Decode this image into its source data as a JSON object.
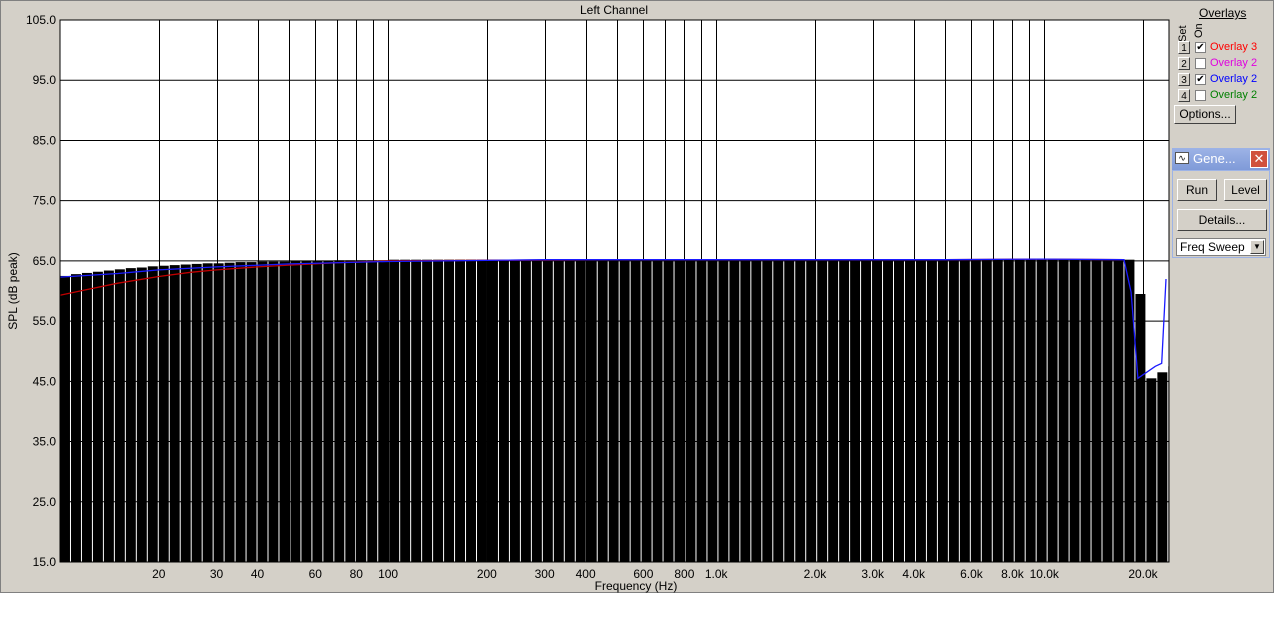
{
  "chart_data": {
    "type": "bar",
    "title": "Left Channel",
    "xlabel": "Frequency (Hz)",
    "ylabel": "SPL (dB peak)",
    "xscale": "log",
    "xlim": [
      10,
      24000
    ],
    "ylim": [
      15,
      105
    ],
    "yticks": [
      "15.0",
      "25.0",
      "35.0",
      "45.0",
      "55.0",
      "65.0",
      "75.0",
      "85.0",
      "95.0",
      "105.0"
    ],
    "xticks": [
      {
        "value": 20,
        "label": "20"
      },
      {
        "value": 30,
        "label": "30"
      },
      {
        "value": 40,
        "label": "40"
      },
      {
        "value": 60,
        "label": "60"
      },
      {
        "value": 80,
        "label": "80"
      },
      {
        "value": 100,
        "label": "100"
      },
      {
        "value": 200,
        "label": "200"
      },
      {
        "value": 300,
        "label": "300"
      },
      {
        "value": 400,
        "label": "400"
      },
      {
        "value": 600,
        "label": "600"
      },
      {
        "value": 800,
        "label": "800"
      },
      {
        "value": 1000,
        "label": "1.0k"
      },
      {
        "value": 2000,
        "label": "2.0k"
      },
      {
        "value": 3000,
        "label": "3.0k"
      },
      {
        "value": 4000,
        "label": "4.0k"
      },
      {
        "value": 6000,
        "label": "6.0k"
      },
      {
        "value": 8000,
        "label": "8.0k"
      },
      {
        "value": 10000,
        "label": "10.0k"
      },
      {
        "value": 20000,
        "label": "20.0k"
      }
    ],
    "xgrid": [
      20,
      30,
      40,
      50,
      60,
      70,
      80,
      90,
      100,
      200,
      300,
      400,
      500,
      600,
      700,
      800,
      900,
      1000,
      2000,
      3000,
      4000,
      5000,
      6000,
      7000,
      8000,
      9000,
      10000,
      20000
    ],
    "grid": true,
    "bars_per_octave": 9,
    "bar_levels": [
      62.5,
      62.8,
      63.0,
      63.2,
      63.4,
      63.6,
      63.8,
      63.9,
      64.1,
      64.2,
      64.3,
      64.4,
      64.5,
      64.6,
      64.6,
      64.7,
      64.8,
      64.8,
      64.9,
      64.9,
      64.9,
      65.0,
      65.0,
      65.0,
      65.0,
      65.1,
      65.1,
      65.1,
      65.1,
      65.1,
      65.2,
      65.2,
      65.2,
      65.2,
      65.2,
      65.2,
      65.2,
      65.2,
      65.2,
      65.2,
      65.2,
      65.2,
      65.2,
      65.2,
      65.2,
      65.2,
      65.2,
      65.2,
      65.2,
      65.2,
      65.2,
      65.2,
      65.2,
      65.2,
      65.2,
      65.2,
      65.2,
      65.2,
      65.2,
      65.2,
      65.2,
      65.2,
      65.2,
      65.2,
      65.2,
      65.2,
      65.2,
      65.2,
      65.2,
      65.2,
      65.2,
      65.2,
      65.2,
      65.2,
      65.2,
      65.2,
      65.2,
      65.2,
      65.2,
      65.2,
      65.2,
      65.2,
      65.2,
      65.2,
      65.2,
      65.2,
      65.2,
      65.2,
      65.2,
      65.2,
      65.2,
      65.2,
      65.2,
      65.2,
      65.2,
      65.2,
      65.2,
      65.2,
      59.5,
      45.5,
      46.5,
      47.5,
      48.0
    ],
    "series": [
      {
        "name": "Overlay 3",
        "color": "#c00000",
        "points": [
          [
            10,
            59.3
          ],
          [
            12,
            60.2
          ],
          [
            15,
            61.3
          ],
          [
            20,
            62.4
          ],
          [
            25,
            63.1
          ],
          [
            30,
            63.5
          ],
          [
            40,
            64.0
          ],
          [
            50,
            64.3
          ],
          [
            70,
            64.7
          ],
          [
            100,
            65.0
          ],
          [
            200,
            65.1
          ],
          [
            500,
            65.2
          ],
          [
            1000,
            65.2
          ],
          [
            5000,
            65.2
          ],
          [
            10000,
            65.3
          ],
          [
            17500,
            65.2
          ]
        ]
      },
      {
        "name": "Overlay 2",
        "color": "#1a1aff",
        "points": [
          [
            10,
            62.3
          ],
          [
            15,
            62.9
          ],
          [
            20,
            63.5
          ],
          [
            30,
            64.0
          ],
          [
            50,
            64.5
          ],
          [
            100,
            64.9
          ],
          [
            300,
            65.2
          ],
          [
            1000,
            65.2
          ],
          [
            5000,
            65.2
          ],
          [
            10000,
            65.3
          ],
          [
            17500,
            65.2
          ],
          [
            18400,
            59.8
          ],
          [
            19300,
            45.5
          ],
          [
            21800,
            47.5
          ],
          [
            22800,
            48.0
          ],
          [
            23500,
            62.0
          ]
        ]
      }
    ]
  },
  "overlays": {
    "header": "Overlays",
    "set_label": "Set",
    "on_label": "On",
    "items": [
      {
        "set": "1",
        "checked": true,
        "name": "Overlay 3",
        "color": "#ff0000"
      },
      {
        "set": "2",
        "checked": false,
        "name": "Overlay 2",
        "color": "#e000e0"
      },
      {
        "set": "3",
        "checked": true,
        "name": "Overlay 2",
        "color": "#0000ff"
      },
      {
        "set": "4",
        "checked": false,
        "name": "Overlay 2",
        "color": "#008000"
      }
    ],
    "options_label": "Options..."
  },
  "generator": {
    "title": "Gene...",
    "run_label": "Run",
    "level_label": "Level",
    "details_label": "Details...",
    "sweep_value": "Freq Sweep"
  }
}
